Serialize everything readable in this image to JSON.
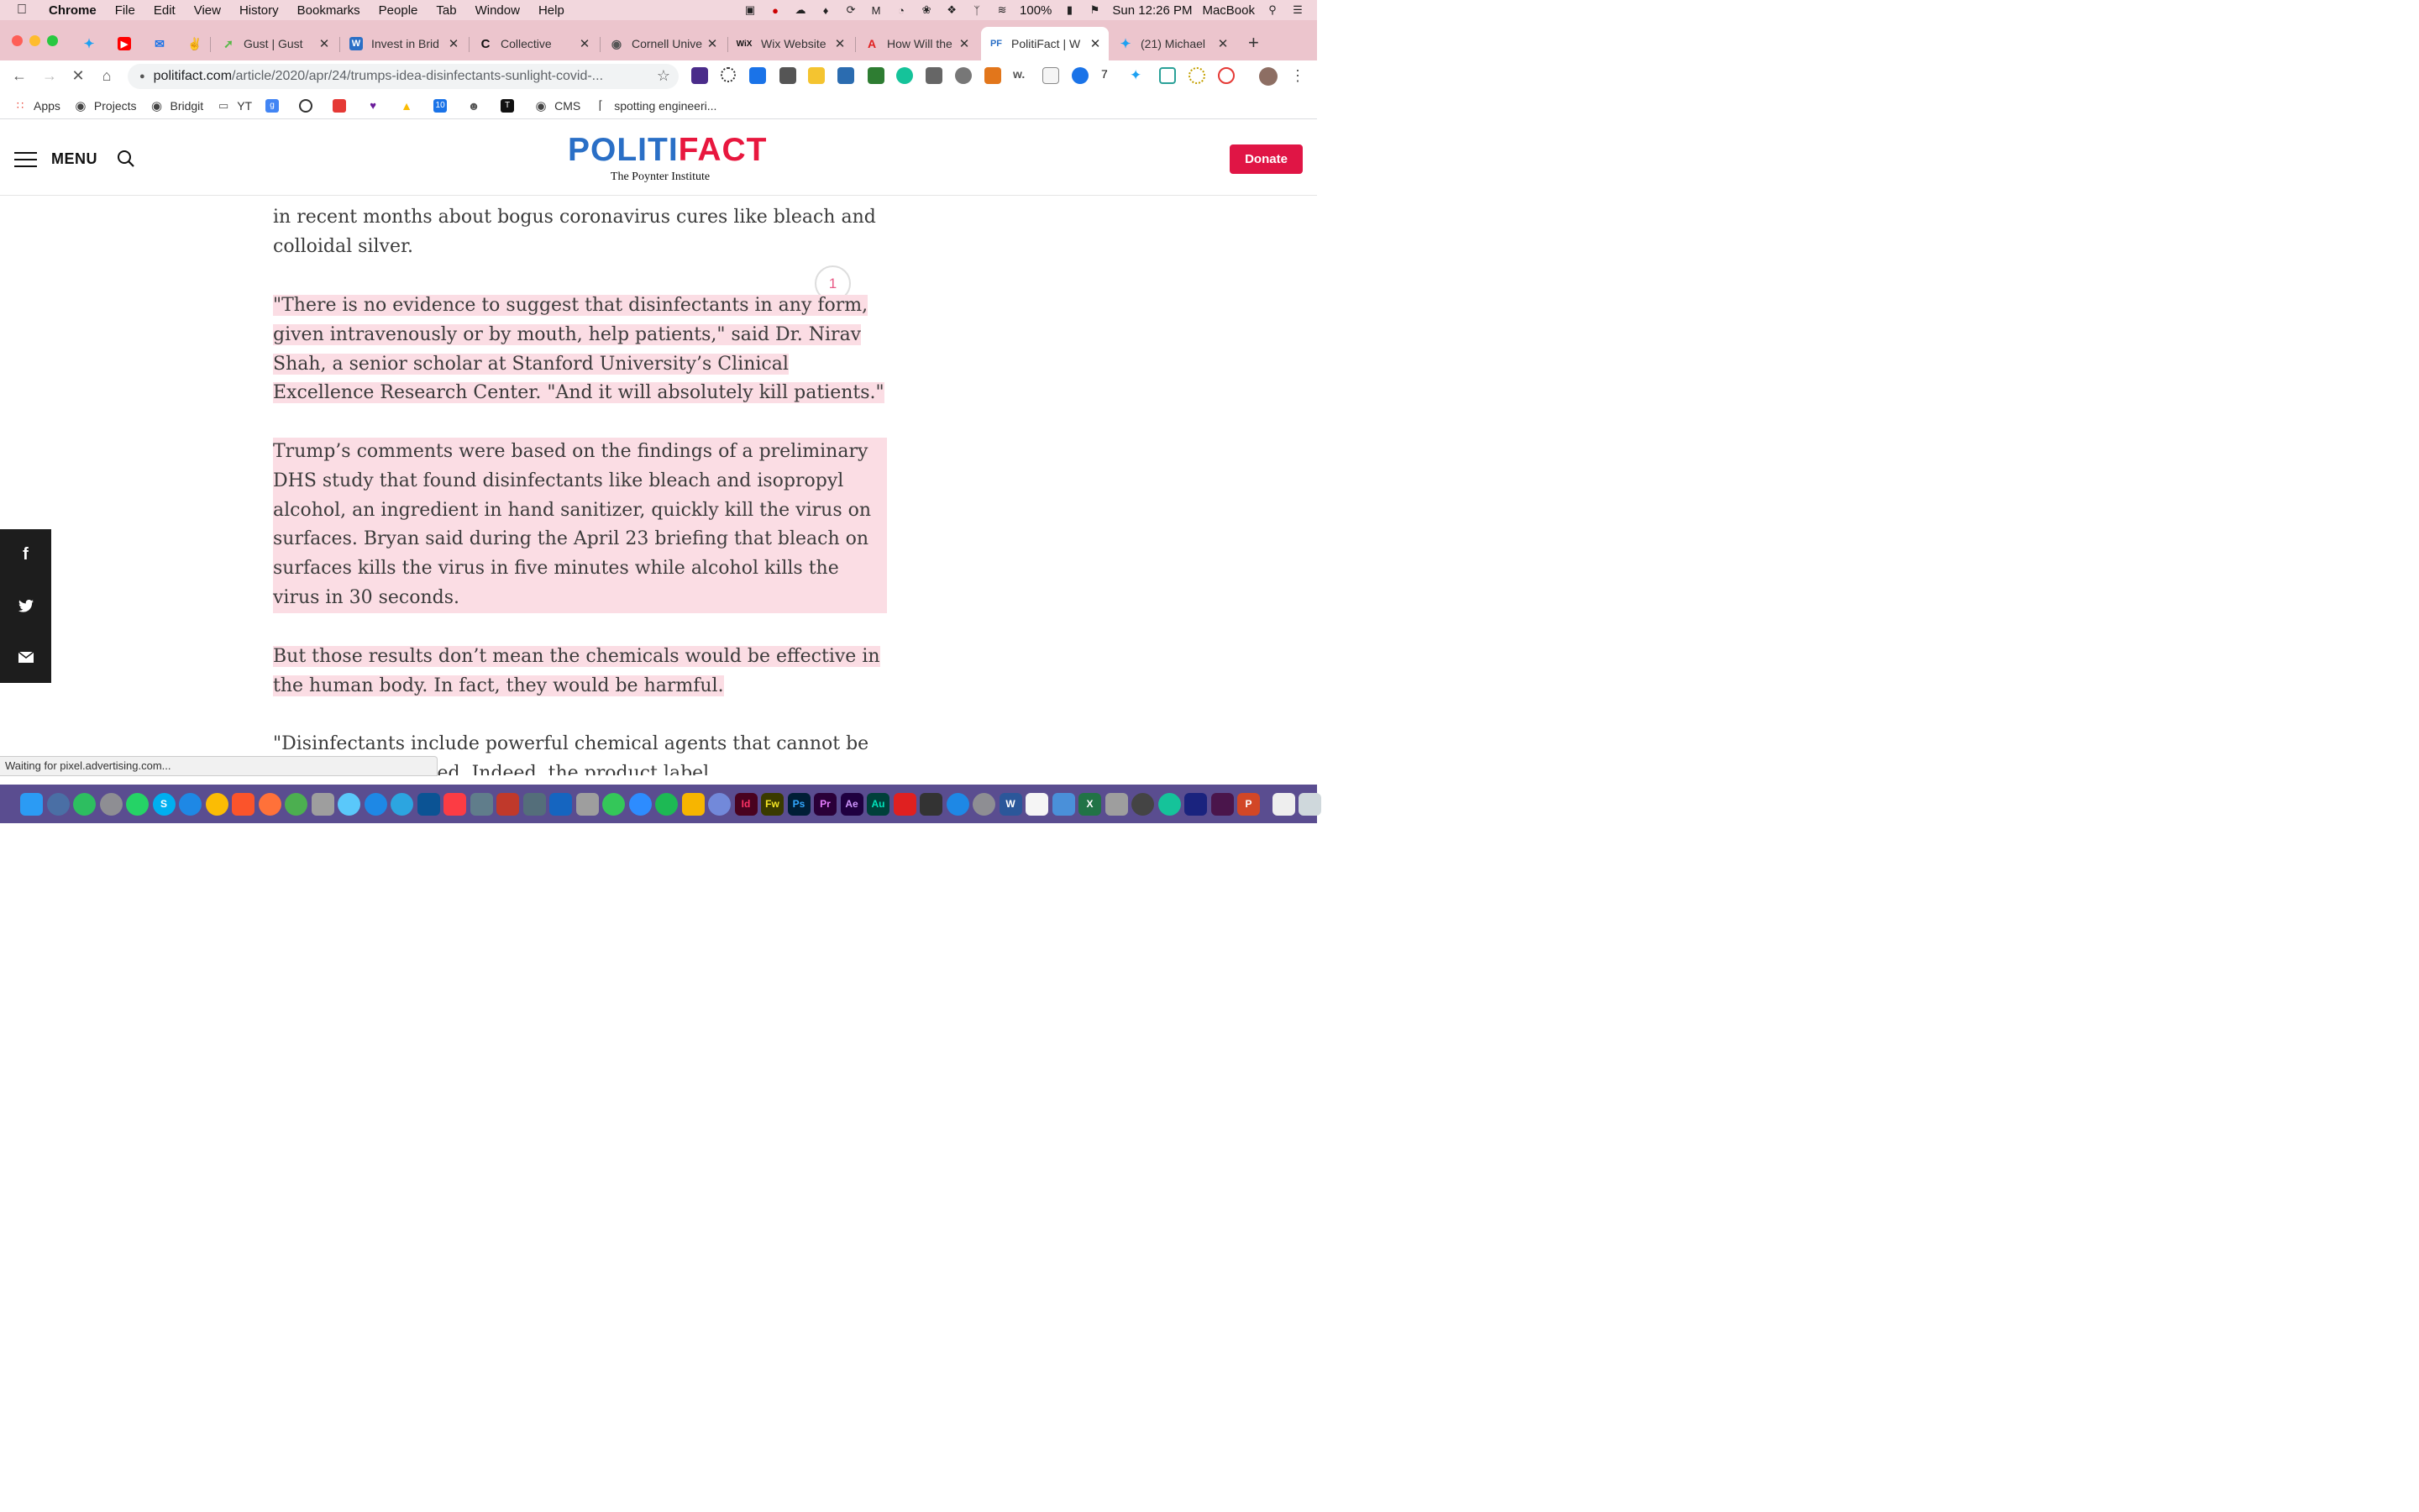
{
  "menubar": {
    "app": "Chrome",
    "items": [
      "File",
      "Edit",
      "View",
      "History",
      "Bookmarks",
      "People",
      "Tab",
      "Window",
      "Help"
    ],
    "status": {
      "battery": "100%",
      "datetime": "Sun 12:26 PM",
      "user": "MacBook"
    }
  },
  "tabs": [
    {
      "label": "",
      "favicon": "twitter-icon",
      "color": "#1da1f2"
    },
    {
      "label": "",
      "favicon": "youtube-icon",
      "color": "#ff0000"
    },
    {
      "label": "",
      "favicon": "mail-icon",
      "color": "#1a73e8"
    },
    {
      "label": "",
      "favicon": "angellist-icon",
      "color": "#333333"
    },
    {
      "label": "Gust | Gust",
      "favicon": "gust-icon",
      "color": "#58b947"
    },
    {
      "label": "Invest in Brid",
      "favicon": "wefunder-icon",
      "color": "#2a6fc6"
    },
    {
      "label": "Collective",
      "favicon": "collective-icon",
      "color": "#111111"
    },
    {
      "label": "Cornell Unive",
      "favicon": "globe-icon",
      "color": "#555555"
    },
    {
      "label": "Wix Website",
      "favicon": "wix-icon",
      "color": "#111111"
    },
    {
      "label": "How Will the",
      "favicon": "pdf-icon",
      "color": "#e02020"
    },
    {
      "label": "PolitiFact | W",
      "favicon": "politifact-icon",
      "color": "#2a6fc6",
      "active": true
    },
    {
      "label": "(21) Michael",
      "favicon": "twitter-icon",
      "color": "#1da1f2"
    }
  ],
  "toolbar": {
    "url_host": "politifact.com",
    "url_path": "/article/2020/apr/24/trumps-idea-disinfectants-sunlight-covid-..."
  },
  "bookmarks": [
    {
      "label": "Apps",
      "icon": "apps-grid-icon"
    },
    {
      "label": "Projects",
      "icon": "globe-icon"
    },
    {
      "label": "Bridgit",
      "icon": "globe-icon"
    },
    {
      "label": "YT",
      "icon": "folder-icon"
    },
    {
      "label": "",
      "icon": "google-icon"
    },
    {
      "label": "",
      "icon": "circle-icon"
    },
    {
      "label": "",
      "icon": "bookmark-red-icon"
    },
    {
      "label": "",
      "icon": "heart-icon"
    },
    {
      "label": "",
      "icon": "drive-icon"
    },
    {
      "label": "",
      "icon": "calendar-icon"
    },
    {
      "label": "",
      "icon": "reddit-icon"
    },
    {
      "label": "",
      "icon": "nyt-icon"
    },
    {
      "label": "CMS",
      "icon": "globe-icon"
    },
    {
      "label": "spotting engineeri...",
      "icon": "page-icon"
    }
  ],
  "site": {
    "menu_label": "MENU",
    "logo_part1": "POLITI",
    "logo_part2": "FACT",
    "logo_sub": "The Poynter Institute",
    "donate_label": "Donate"
  },
  "article": {
    "cut_line": "",
    "p1": "in recent months about bogus coronavirus cures like bleach and colloidal silver.",
    "p2": "\"There is no evidence to suggest that disinfectants in any form, given intravenously or by mouth, help patients,\" said Dr. Nirav Shah, a senior scholar at Stanford University’s Clinical Excellence Research Center. \"And it will absolutely kill patients.\"",
    "p3": "Trump’s comments were based on the findings of a preliminary DHS study that found disinfectants like bleach and isopropyl alcohol, an ingredient in hand sanitizer, quickly kill the virus on surfaces. Bryan said during the April 23 briefing that bleach on surfaces kills the virus in five minutes while alcohol kills the virus in 30 seconds.",
    "p4": "But those results don’t mean the chemicals would be effective in the human body. In fact, they would be harmful.",
    "p5": "\"Disinfectants include powerful chemical agents that cannot be ingested or injected. Indeed, the product label",
    "annotation_count": "1"
  },
  "share": [
    "facebook-icon",
    "twitter-icon",
    "email-icon"
  ],
  "status_bubble": "Waiting for pixel.advertising.com...",
  "colors": {
    "highlight": "#fbdde4",
    "donate": "#e01545",
    "logo_blue": "#2a6fc6",
    "logo_red": "#e8173e"
  }
}
